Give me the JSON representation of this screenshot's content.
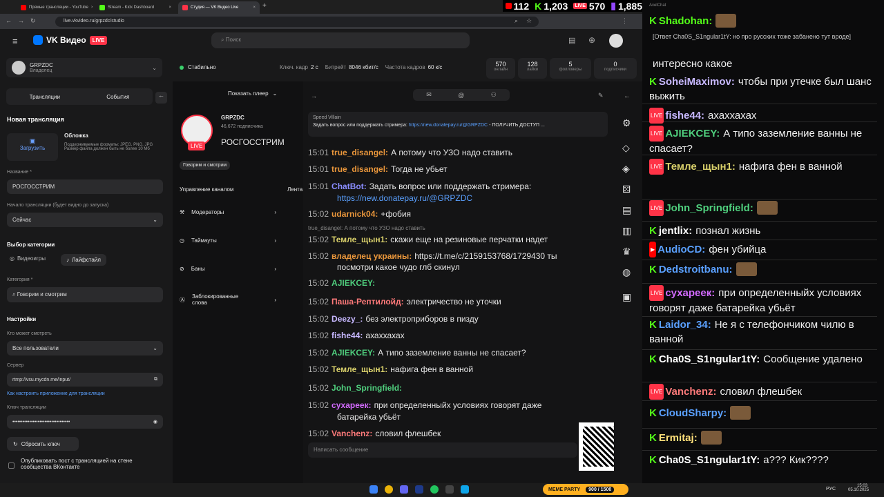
{
  "browser": {
    "tabs": [
      {
        "label": "Прямые трансляции - YouTube",
        "color": "#ff0000"
      },
      {
        "label": "Stream - Kick Dashboard",
        "color": "#53fc18"
      },
      {
        "label": "Студия — VK Видео Live",
        "color": "#ff3347"
      }
    ],
    "url": "live.vkvideo.ru/grpzdc/studio"
  },
  "counters": {
    "youtube": "112",
    "kick": "1,203",
    "vk": "570",
    "twitch": "1,885"
  },
  "header": {
    "logo": "VK Видео",
    "live": "LIVE",
    "search_placeholder": "Поиск"
  },
  "channel": {
    "name": "GRPZDC",
    "role": "Владелец"
  },
  "status": {
    "label": "Стабильно",
    "keyframe_label": "Ключ. кадр",
    "keyframe": "2 с",
    "bitrate_label": "Битрейт",
    "bitrate": "8046 кбит/с",
    "fps_label": "Частота кадров",
    "fps": "60 к/с",
    "stats": [
      {
        "value": "570",
        "label": "онлайн"
      },
      {
        "value": "128",
        "label": "лайки"
      },
      {
        "value": "5",
        "label": "фолловеры"
      },
      {
        "value": "0",
        "label": "подписчики"
      }
    ]
  },
  "left": {
    "tab_streams": "Трансляции",
    "tab_events": "События",
    "new_stream": "Новая трансляция",
    "cover_title": "Обложка",
    "upload": "Загрузить",
    "cover_hint": "Поддерживаемые форматы: JPEG, PNG, JPG Размер файла должен быть не более 10 Мб",
    "title_label": "Название *",
    "title_value": "РОСГОССТРИМ",
    "start_label": "Начало трансляции (будет видно до запуска)",
    "start_value": "Сейчас",
    "category_section": "Выбор категории",
    "cat_games": "Видеоигры",
    "cat_life": "Лайфстайл",
    "category_label": "Категория *",
    "category_value": "Говорим и смотрим",
    "settings": "Настройки",
    "who_label": "Кто может смотреть",
    "who_value": "Все пользователи",
    "server_label": "Сервер",
    "server_value": "rtmp://vsu.mycdn.me/input/",
    "howto": "Как настроить приложение для трансляции",
    "key_label": "Ключ трансляции",
    "key_value": "••••••••••••••••••••••••••••••••••",
    "reset_key": "Сбросить ключ",
    "publish": "Опубликовать пост с трансляцией на стене сообщества ВКонтакте"
  },
  "mid": {
    "show_player": "Показать плеер",
    "streamer": "GRPZDC",
    "subs": "46,672 подписчика",
    "live": "LIVE",
    "stream_title": "РОСГОССТРИМ",
    "tag": "Говорим и смотрим",
    "manage": "Управление каналом",
    "feed": "Лента",
    "menu": [
      "Модераторы",
      "Таймауты",
      "Баны",
      "Заблокированные слова"
    ]
  },
  "chat": {
    "pinned_author": "Speed Villain",
    "pinned_text": "Задать вопрос или поддержать стримера: ",
    "pinned_link": "https://new.donatepay.ru/@GRPZDC",
    "pinned_tail": " - ПОЛУЧИТЬ ДОСТУП ...",
    "reply_quote": "true_disangel: А потому что УЗО надо ставить",
    "input_placeholder": "Написать сообщение",
    "messages": [
      {
        "time": "15:01",
        "user": "true_disangel:",
        "color": "#e9963b",
        "text": "А потому что УЗО надо ставить"
      },
      {
        "time": "15:01",
        "user": "true_disangel:",
        "color": "#e9963b",
        "text": "Тогда не убьет"
      },
      {
        "time": "15:01",
        "user": "ChatBot:",
        "color": "#8a8dff",
        "text": "Задать вопрос или поддержать стримера:"
      },
      {
        "time": "",
        "user": "",
        "color": "#5aa0ff",
        "text": "https://new.donatepay.ru/@GRPZDC"
      },
      {
        "time": "15:02",
        "user": "udarnick04:",
        "color": "#e9963b",
        "text": "+фобия"
      },
      {
        "time": "15:02",
        "user": "Темле_щын1:",
        "color": "#d8cf6a",
        "text": "скажи еще на резиновые перчатки надет"
      },
      {
        "time": "15:02",
        "user": "владелец украины:",
        "color": "#e9963b",
        "text": "https://t.me/c/2159153768/1729430 ты"
      },
      {
        "time": "",
        "user": "",
        "color": "#e6e6e6",
        "text": "посмотри какое чудо глб скинул"
      },
      {
        "time": "15:02",
        "user": "AJIEKCEY:",
        "color": "#4fce7d",
        "text": ""
      },
      {
        "time": "15:02",
        "user": "Паша-Рептилойд:",
        "color": "#ff7a7a",
        "text": "электричество не уточки"
      },
      {
        "time": "15:02",
        "user": "Deezy_:",
        "color": "#c7b8ff",
        "text": "без электроприборов в пизду"
      },
      {
        "time": "15:02",
        "user": "fishe44:",
        "color": "#c7b8ff",
        "text": "ахаххахах"
      },
      {
        "time": "15:02",
        "user": "AJIEKCEY:",
        "color": "#4fce7d",
        "text": "А типо заземление ванны не спасает?"
      },
      {
        "time": "15:02",
        "user": "Темле_щын1:",
        "color": "#d8cf6a",
        "text": "нафига фен в ванной"
      },
      {
        "time": "15:02",
        "user": "John_Springfield:",
        "color": "#4fce7d",
        "text": ""
      },
      {
        "time": "15:02",
        "user": "сухареек:",
        "color": "#d36bff",
        "text": "при определенныйх условиях говорят даже"
      },
      {
        "time": "",
        "user": "",
        "color": "#e6e6e6",
        "text": "батарейка убьёт"
      },
      {
        "time": "15:02",
        "user": "Vanchenz:",
        "color": "#ff7a7a",
        "text": "словил флешбек"
      }
    ]
  },
  "overlay": {
    "title": "AxelChat",
    "messages": [
      {
        "src": "kick",
        "user": "Shadohan:",
        "color": "#53fc18",
        "text": ""
      },
      {
        "src": "",
        "user": "",
        "color": "#ccc",
        "text": "[Ответ Cha0S_S1ngular1tY: но про русских тоже забанено тут вроде]"
      },
      {
        "src": "",
        "user": "",
        "color": "#f0f0f0",
        "text": "интересно какое"
      },
      {
        "src": "kick",
        "user": "SoheiMaximov:",
        "color": "#c7b8ff",
        "text": "чтобы при утечке был шанс выжить"
      },
      {
        "src": "vk",
        "user": "fishe44:",
        "color": "#c7b8ff",
        "text": "ахаххахах"
      },
      {
        "src": "vk",
        "user": "AJIEKCEY:",
        "color": "#4fce7d",
        "text": "А типо заземление ванны не спасает?"
      },
      {
        "src": "vk",
        "user": "Темле_щын1:",
        "color": "#d8cf6a",
        "text": "нафига фен в ванной"
      },
      {
        "src": "vk",
        "user": "John_Springfield:",
        "color": "#4fce7d",
        "text": ""
      },
      {
        "src": "kick",
        "user": "jentlix:",
        "color": "#ffffff",
        "text": "познал жизнь"
      },
      {
        "src": "yt",
        "user": "AudioCD:",
        "color": "#5aa0ff",
        "text": "фен убийца"
      },
      {
        "src": "kick",
        "user": "Dedstroitbanu:",
        "color": "#5aa0ff",
        "text": ""
      },
      {
        "src": "vk",
        "user": "сухареек:",
        "color": "#d36bff",
        "text": "при определенныйх условиях говорят даже батарейка убьёт"
      },
      {
        "src": "kick",
        "user": "Laidor_34:",
        "color": "#5aa0ff",
        "text": "Не я с телефончиком чилю в ванной"
      },
      {
        "src": "kick",
        "user": "Cha0S_S1ngular1tY:",
        "color": "#ffffff",
        "text": "Сообщение удалено"
      },
      {
        "src": "vk",
        "user": "Vanchenz:",
        "color": "#ff7a7a",
        "text": "словил флешбек"
      },
      {
        "src": "kick",
        "user": "CloudSharpy:",
        "color": "#5aa0ff",
        "text": ""
      },
      {
        "src": "kick",
        "user": "Ermitaj:",
        "color": "#ffe07a",
        "text": ""
      },
      {
        "src": "kick",
        "user": "Cha0S_S1ngular1tY:",
        "color": "#ffffff",
        "text": "а??? Кик????"
      }
    ]
  },
  "taskbar": {
    "lang": "РУС",
    "time": "15:03",
    "date": "05.10.2025",
    "meme": "MEME PARTY",
    "meme_count": "900 / 1500"
  }
}
